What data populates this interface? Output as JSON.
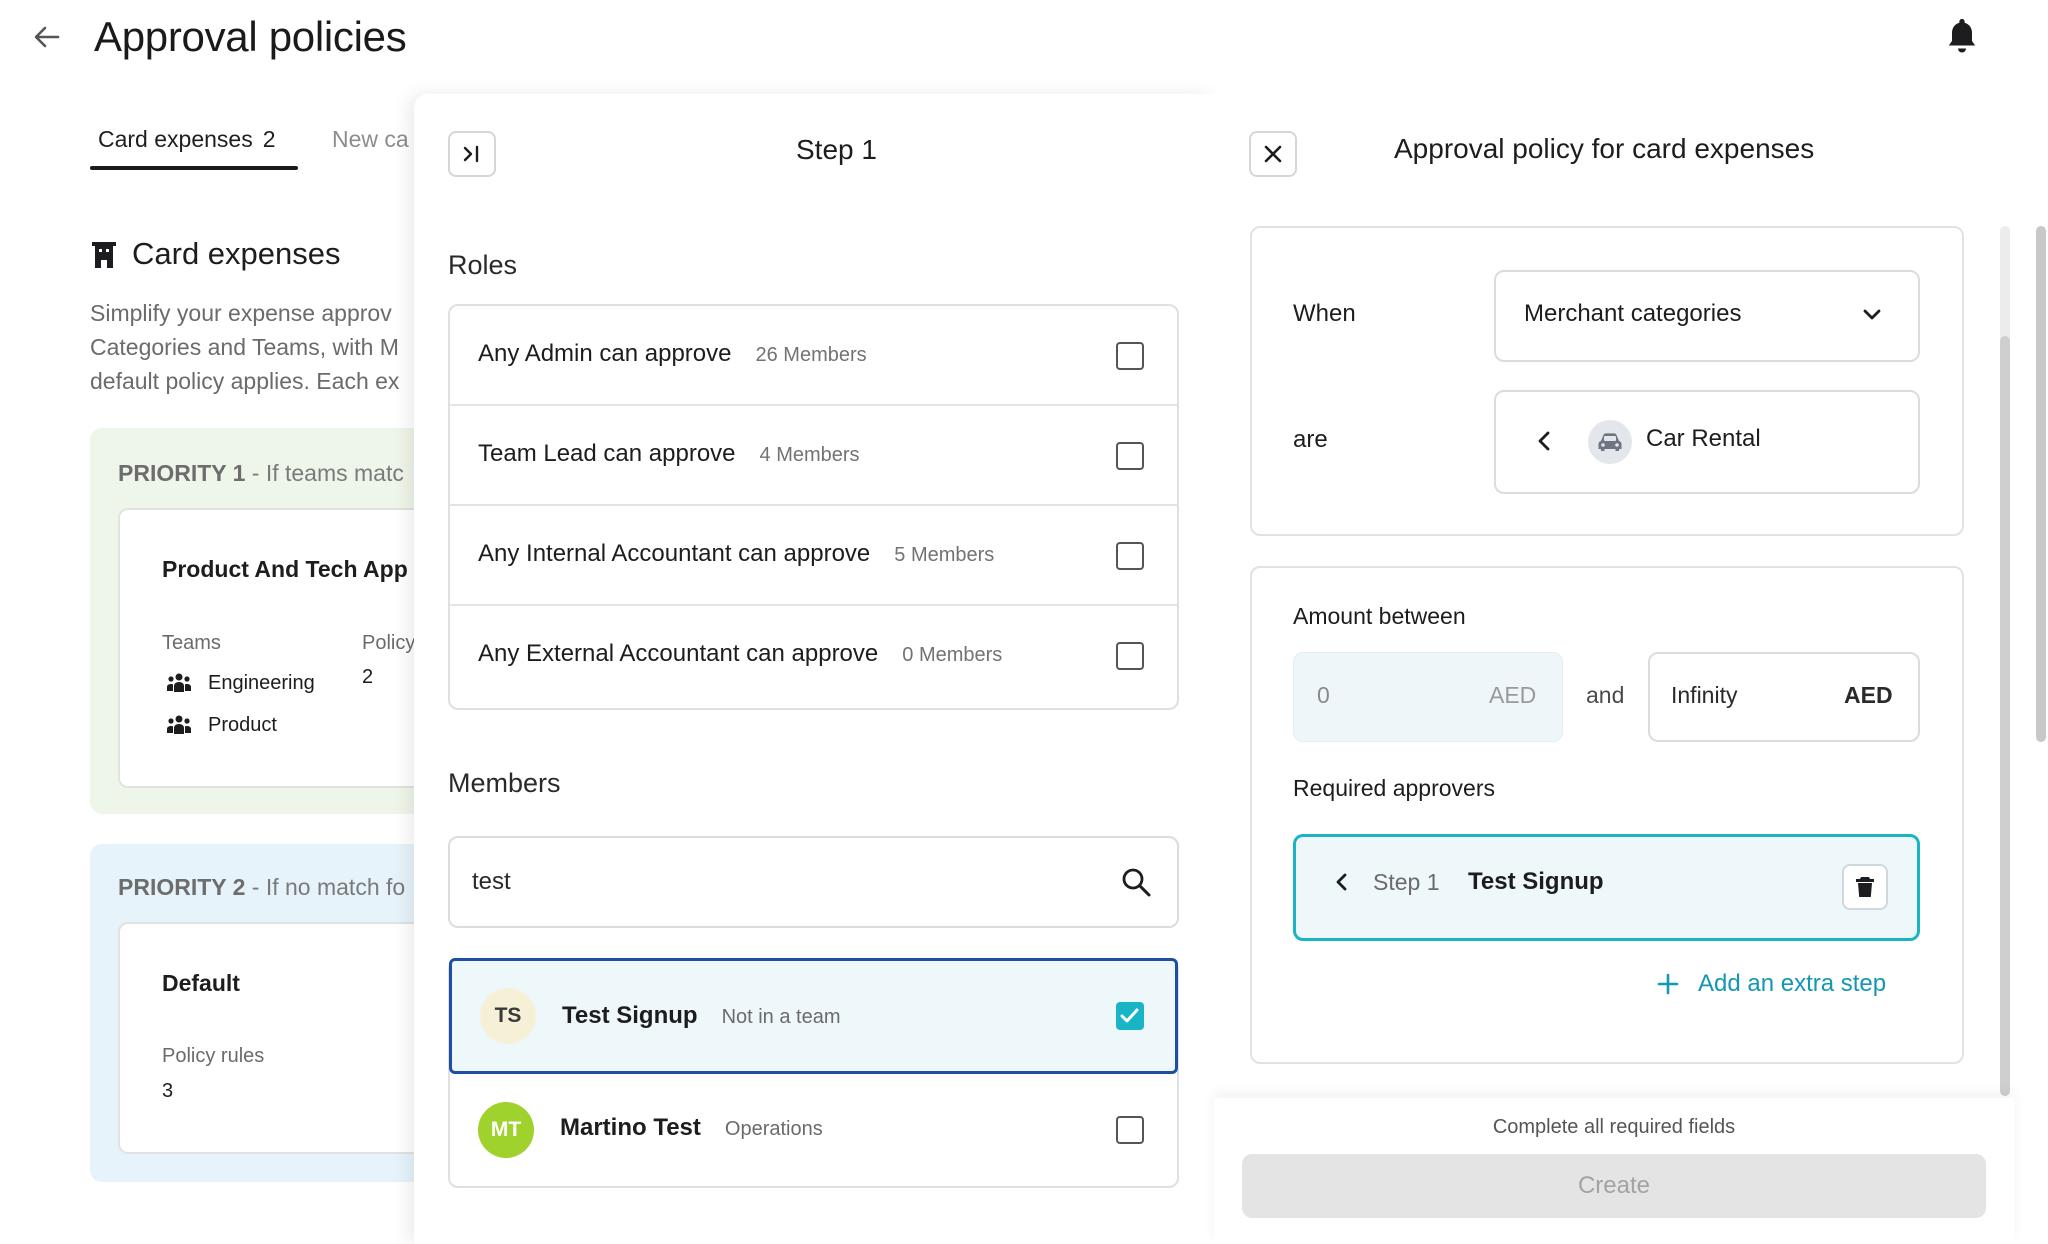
{
  "header": {
    "title": "Approval policies"
  },
  "tabs": [
    {
      "label": "Card expenses",
      "count": "2"
    },
    {
      "label": "New ca"
    }
  ],
  "background": {
    "section_title": "Card expenses",
    "description": [
      "Simplify your expense approv",
      "Categories and Teams, with M",
      "default policy applies. Each ex"
    ],
    "priority1": {
      "label_bold": "PRIORITY 1",
      "label_rest": " - If teams matc",
      "card_title": "Product And Tech App",
      "teams_label": "Teams",
      "policy_label": "Policy",
      "policy_value": "2",
      "teams": [
        "Engineering",
        "Product"
      ]
    },
    "priority2": {
      "label_bold": "PRIORITY 2",
      "label_rest": " - If no match fo",
      "card_title": "Default",
      "rules_label": "Policy rules",
      "rules_value": "3"
    }
  },
  "step_panel": {
    "title": "Step 1",
    "roles_title": "Roles",
    "roles": [
      {
        "name": "Any Admin can approve",
        "count": "26 Members",
        "checked": false
      },
      {
        "name": "Team Lead can approve",
        "count": "4 Members",
        "checked": false
      },
      {
        "name": "Any Internal Accountant can approve",
        "count": "5 Members",
        "checked": false
      },
      {
        "name": "Any External Accountant can approve",
        "count": "0 Members",
        "checked": false
      }
    ],
    "members_title": "Members",
    "search_value": "test",
    "members": [
      {
        "initials": "TS",
        "name": "Test Signup",
        "team": "Not in a team",
        "checked": true,
        "avatar_color": "#f6f1d6",
        "avatar_text_color": "#3a3a3a"
      },
      {
        "initials": "MT",
        "name": "Martino Test",
        "team": "Operations",
        "checked": false,
        "avatar_color": "#9fd22c",
        "avatar_text_color": "#ffffff"
      }
    ]
  },
  "policy_panel": {
    "title": "Approval policy for card expenses",
    "when_label": "When",
    "when_value": "Merchant categories",
    "are_label": "are",
    "are_value": "Car Rental",
    "amount_title": "Amount between",
    "min_value": "0",
    "min_currency": "AED",
    "and_label": "and",
    "max_value": "Infinity",
    "max_currency": "AED",
    "approvers_title": "Required approvers",
    "step_label": "Step 1",
    "step_member": "Test Signup",
    "add_step_label": "Add an extra step",
    "footer_hint": "Complete all required fields",
    "create_label": "Create"
  },
  "colors": {
    "accent": "#1497b1",
    "selected_border": "#1e4fa3",
    "checkbox_checked": "#19b5c6",
    "priority1_bg": "#eef6ea",
    "priority2_bg": "#e7f3fa"
  }
}
